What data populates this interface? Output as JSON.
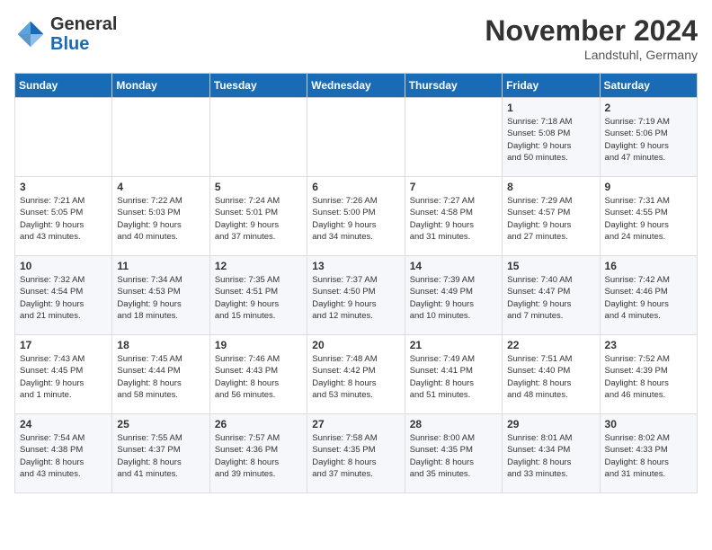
{
  "header": {
    "logo_general": "General",
    "logo_blue": "Blue",
    "month_title": "November 2024",
    "location": "Landstuhl, Germany"
  },
  "days_of_week": [
    "Sunday",
    "Monday",
    "Tuesday",
    "Wednesday",
    "Thursday",
    "Friday",
    "Saturday"
  ],
  "weeks": [
    [
      {
        "day": "",
        "info": ""
      },
      {
        "day": "",
        "info": ""
      },
      {
        "day": "",
        "info": ""
      },
      {
        "day": "",
        "info": ""
      },
      {
        "day": "",
        "info": ""
      },
      {
        "day": "1",
        "info": "Sunrise: 7:18 AM\nSunset: 5:08 PM\nDaylight: 9 hours\nand 50 minutes."
      },
      {
        "day": "2",
        "info": "Sunrise: 7:19 AM\nSunset: 5:06 PM\nDaylight: 9 hours\nand 47 minutes."
      }
    ],
    [
      {
        "day": "3",
        "info": "Sunrise: 7:21 AM\nSunset: 5:05 PM\nDaylight: 9 hours\nand 43 minutes."
      },
      {
        "day": "4",
        "info": "Sunrise: 7:22 AM\nSunset: 5:03 PM\nDaylight: 9 hours\nand 40 minutes."
      },
      {
        "day": "5",
        "info": "Sunrise: 7:24 AM\nSunset: 5:01 PM\nDaylight: 9 hours\nand 37 minutes."
      },
      {
        "day": "6",
        "info": "Sunrise: 7:26 AM\nSunset: 5:00 PM\nDaylight: 9 hours\nand 34 minutes."
      },
      {
        "day": "7",
        "info": "Sunrise: 7:27 AM\nSunset: 4:58 PM\nDaylight: 9 hours\nand 31 minutes."
      },
      {
        "day": "8",
        "info": "Sunrise: 7:29 AM\nSunset: 4:57 PM\nDaylight: 9 hours\nand 27 minutes."
      },
      {
        "day": "9",
        "info": "Sunrise: 7:31 AM\nSunset: 4:55 PM\nDaylight: 9 hours\nand 24 minutes."
      }
    ],
    [
      {
        "day": "10",
        "info": "Sunrise: 7:32 AM\nSunset: 4:54 PM\nDaylight: 9 hours\nand 21 minutes."
      },
      {
        "day": "11",
        "info": "Sunrise: 7:34 AM\nSunset: 4:53 PM\nDaylight: 9 hours\nand 18 minutes."
      },
      {
        "day": "12",
        "info": "Sunrise: 7:35 AM\nSunset: 4:51 PM\nDaylight: 9 hours\nand 15 minutes."
      },
      {
        "day": "13",
        "info": "Sunrise: 7:37 AM\nSunset: 4:50 PM\nDaylight: 9 hours\nand 12 minutes."
      },
      {
        "day": "14",
        "info": "Sunrise: 7:39 AM\nSunset: 4:49 PM\nDaylight: 9 hours\nand 10 minutes."
      },
      {
        "day": "15",
        "info": "Sunrise: 7:40 AM\nSunset: 4:47 PM\nDaylight: 9 hours\nand 7 minutes."
      },
      {
        "day": "16",
        "info": "Sunrise: 7:42 AM\nSunset: 4:46 PM\nDaylight: 9 hours\nand 4 minutes."
      }
    ],
    [
      {
        "day": "17",
        "info": "Sunrise: 7:43 AM\nSunset: 4:45 PM\nDaylight: 9 hours\nand 1 minute."
      },
      {
        "day": "18",
        "info": "Sunrise: 7:45 AM\nSunset: 4:44 PM\nDaylight: 8 hours\nand 58 minutes."
      },
      {
        "day": "19",
        "info": "Sunrise: 7:46 AM\nSunset: 4:43 PM\nDaylight: 8 hours\nand 56 minutes."
      },
      {
        "day": "20",
        "info": "Sunrise: 7:48 AM\nSunset: 4:42 PM\nDaylight: 8 hours\nand 53 minutes."
      },
      {
        "day": "21",
        "info": "Sunrise: 7:49 AM\nSunset: 4:41 PM\nDaylight: 8 hours\nand 51 minutes."
      },
      {
        "day": "22",
        "info": "Sunrise: 7:51 AM\nSunset: 4:40 PM\nDaylight: 8 hours\nand 48 minutes."
      },
      {
        "day": "23",
        "info": "Sunrise: 7:52 AM\nSunset: 4:39 PM\nDaylight: 8 hours\nand 46 minutes."
      }
    ],
    [
      {
        "day": "24",
        "info": "Sunrise: 7:54 AM\nSunset: 4:38 PM\nDaylight: 8 hours\nand 43 minutes."
      },
      {
        "day": "25",
        "info": "Sunrise: 7:55 AM\nSunset: 4:37 PM\nDaylight: 8 hours\nand 41 minutes."
      },
      {
        "day": "26",
        "info": "Sunrise: 7:57 AM\nSunset: 4:36 PM\nDaylight: 8 hours\nand 39 minutes."
      },
      {
        "day": "27",
        "info": "Sunrise: 7:58 AM\nSunset: 4:35 PM\nDaylight: 8 hours\nand 37 minutes."
      },
      {
        "day": "28",
        "info": "Sunrise: 8:00 AM\nSunset: 4:35 PM\nDaylight: 8 hours\nand 35 minutes."
      },
      {
        "day": "29",
        "info": "Sunrise: 8:01 AM\nSunset: 4:34 PM\nDaylight: 8 hours\nand 33 minutes."
      },
      {
        "day": "30",
        "info": "Sunrise: 8:02 AM\nSunset: 4:33 PM\nDaylight: 8 hours\nand 31 minutes."
      }
    ]
  ]
}
